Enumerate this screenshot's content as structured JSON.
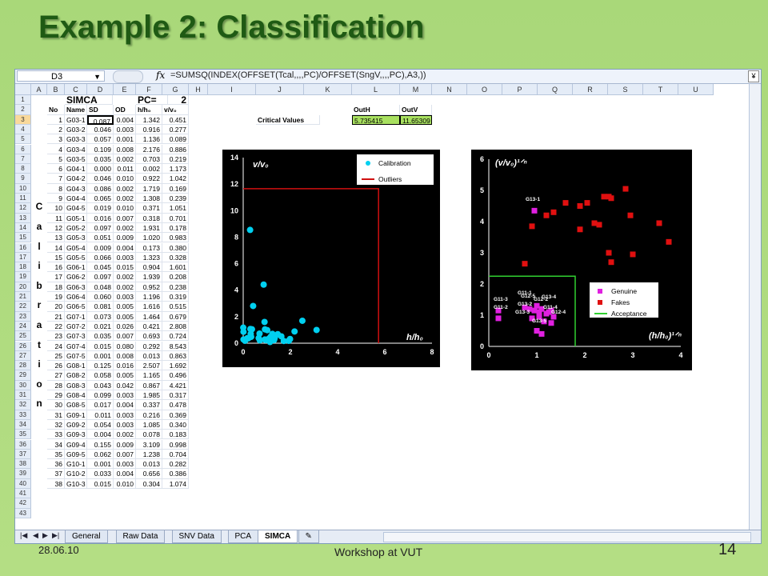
{
  "slide": {
    "title": "Example 2: Classification",
    "date": "28.06.10",
    "footer": "Workshop at VUT",
    "page": "14"
  },
  "formula_bar": {
    "name_box": "D3",
    "fx": "fx",
    "formula": "=SUMSQ(INDEX(OFFSET(Tcal,,,,PC)/OFFSET(SngV,,,,PC),A3,))"
  },
  "columns": [
    "A",
    "B",
    "C",
    "D",
    "E",
    "F",
    "G",
    "H",
    "I",
    "J",
    "K",
    "L",
    "M",
    "N",
    "O",
    "P",
    "Q",
    "R",
    "S",
    "T",
    "U"
  ],
  "sheet": {
    "title": "SIMCA",
    "pc_label": "PC=",
    "pc_value": "2",
    "headers": [
      "No",
      "Name",
      "SD",
      "OD",
      "h/h₀",
      "v/v₀"
    ],
    "critical_label": "Critical Values",
    "outh_label": "OutH",
    "outv_label": "OutV",
    "outh_value": "5.735415",
    "outv_value": "11.65309",
    "calibration_letters": [
      "C",
      "a",
      "l",
      "i",
      "b",
      "r",
      "a",
      "t",
      "i",
      "o",
      "n"
    ],
    "rows": [
      [
        "1",
        "G03-1",
        "0.087",
        "0.004",
        "1.342",
        "0.451"
      ],
      [
        "2",
        "G03-2",
        "0.046",
        "0.003",
        "0.916",
        "0.277"
      ],
      [
        "3",
        "G03-3",
        "0.057",
        "0.001",
        "1.136",
        "0.089"
      ],
      [
        "4",
        "G03-4",
        "0.109",
        "0.008",
        "2.176",
        "0.886"
      ],
      [
        "5",
        "G03-5",
        "0.035",
        "0.002",
        "0.703",
        "0.219"
      ],
      [
        "6",
        "G04-1",
        "0.000",
        "0.011",
        "0.002",
        "1.173"
      ],
      [
        "7",
        "G04-2",
        "0.046",
        "0.010",
        "0.922",
        "1.042"
      ],
      [
        "8",
        "G04-3",
        "0.086",
        "0.002",
        "1.719",
        "0.169"
      ],
      [
        "9",
        "G04-4",
        "0.065",
        "0.002",
        "1.308",
        "0.239"
      ],
      [
        "10",
        "G04-5",
        "0.019",
        "0.010",
        "0.371",
        "1.051"
      ],
      [
        "11",
        "G05-1",
        "0.016",
        "0.007",
        "0.318",
        "0.701"
      ],
      [
        "12",
        "G05-2",
        "0.097",
        "0.002",
        "1.931",
        "0.178"
      ],
      [
        "13",
        "G05-3",
        "0.051",
        "0.009",
        "1.020",
        "0.983"
      ],
      [
        "14",
        "G05-4",
        "0.009",
        "0.004",
        "0.173",
        "0.380"
      ],
      [
        "15",
        "G05-5",
        "0.066",
        "0.003",
        "1.323",
        "0.328"
      ],
      [
        "16",
        "G06-1",
        "0.045",
        "0.015",
        "0.904",
        "1.601"
      ],
      [
        "17",
        "G06-2",
        "0.097",
        "0.002",
        "1.939",
        "0.208"
      ],
      [
        "18",
        "G06-3",
        "0.048",
        "0.002",
        "0.952",
        "0.238"
      ],
      [
        "19",
        "G06-4",
        "0.060",
        "0.003",
        "1.196",
        "0.319"
      ],
      [
        "20",
        "G06-5",
        "0.081",
        "0.005",
        "1.616",
        "0.515"
      ],
      [
        "21",
        "G07-1",
        "0.073",
        "0.005",
        "1.464",
        "0.679"
      ],
      [
        "22",
        "G07-2",
        "0.021",
        "0.026",
        "0.421",
        "2.808"
      ],
      [
        "23",
        "G07-3",
        "0.035",
        "0.007",
        "0.693",
        "0.724"
      ],
      [
        "24",
        "G07-4",
        "0.015",
        "0.080",
        "0.292",
        "8.543"
      ],
      [
        "25",
        "G07-5",
        "0.001",
        "0.008",
        "0.013",
        "0.863"
      ],
      [
        "26",
        "G08-1",
        "0.125",
        "0.016",
        "2.507",
        "1.692"
      ],
      [
        "27",
        "G08-2",
        "0.058",
        "0.005",
        "1.165",
        "0.496"
      ],
      [
        "28",
        "G08-3",
        "0.043",
        "0.042",
        "0.867",
        "4.421"
      ],
      [
        "29",
        "G08-4",
        "0.099",
        "0.003",
        "1.985",
        "0.317"
      ],
      [
        "30",
        "G08-5",
        "0.017",
        "0.004",
        "0.337",
        "0.478"
      ],
      [
        "31",
        "G09-1",
        "0.011",
        "0.003",
        "0.216",
        "0.369"
      ],
      [
        "32",
        "G09-2",
        "0.054",
        "0.003",
        "1.085",
        "0.340"
      ],
      [
        "33",
        "G09-3",
        "0.004",
        "0.002",
        "0.078",
        "0.183"
      ],
      [
        "34",
        "G09-4",
        "0.155",
        "0.009",
        "3.109",
        "0.998"
      ],
      [
        "35",
        "G09-5",
        "0.062",
        "0.007",
        "1.238",
        "0.704"
      ],
      [
        "36",
        "G10-1",
        "0.001",
        "0.003",
        "0.013",
        "0.282"
      ],
      [
        "37",
        "G10-2",
        "0.033",
        "0.004",
        "0.656",
        "0.386"
      ],
      [
        "38",
        "G10-3",
        "0.015",
        "0.010",
        "0.304",
        "1.074"
      ]
    ]
  },
  "tabs": [
    "General",
    "Raw Data",
    "SNV Data",
    "PCA",
    "SIMCA"
  ],
  "active_tab": "SIMCA",
  "chart_data": [
    {
      "type": "scatter",
      "title": "",
      "xlabel": "h/h₀",
      "ylabel": "v/v₀",
      "xlim": [
        0,
        8
      ],
      "ylim": [
        0,
        14
      ],
      "xticks": [
        0,
        2,
        4,
        6,
        8
      ],
      "yticks": [
        0,
        2,
        4,
        6,
        8,
        10,
        12,
        14
      ],
      "legend_position": "top-right",
      "series": [
        {
          "name": "Calibration",
          "color": "#00d0f0",
          "x": [
            1.342,
            0.916,
            1.136,
            2.176,
            0.703,
            0.002,
            0.922,
            1.719,
            1.308,
            0.371,
            0.318,
            1.931,
            1.02,
            0.173,
            1.323,
            0.904,
            1.939,
            0.952,
            1.196,
            1.616,
            1.464,
            0.421,
            0.693,
            0.292,
            0.013,
            2.507,
            1.165,
            0.867,
            1.985,
            0.337,
            0.216,
            1.085,
            0.078,
            3.109,
            1.238,
            0.013,
            0.656,
            0.304
          ],
          "y": [
            0.451,
            0.277,
            0.089,
            0.886,
            0.219,
            1.173,
            1.042,
            0.169,
            0.239,
            1.051,
            0.701,
            0.178,
            0.983,
            0.38,
            0.328,
            1.601,
            0.208,
            0.238,
            0.319,
            0.515,
            0.679,
            2.808,
            0.724,
            8.543,
            0.863,
            1.692,
            0.496,
            4.421,
            0.317,
            0.478,
            0.369,
            0.34,
            0.183,
            0.998,
            0.704,
            0.282,
            0.386,
            1.074
          ]
        },
        {
          "name": "Outliers",
          "color": "#d01010",
          "type": "line",
          "x": [
            0,
            5.735,
            5.735
          ],
          "y": [
            11.653,
            11.653,
            0
          ]
        }
      ]
    },
    {
      "type": "scatter",
      "title": "",
      "xlabel": "(h/h₀)¹ᐟⁿ",
      "ylabel": "(v/v₀)¹ᐟⁿ",
      "xlim": [
        0,
        4
      ],
      "ylim": [
        0,
        6
      ],
      "xticks": [
        0,
        1,
        2,
        3,
        4
      ],
      "yticks": [
        0,
        1,
        2,
        3,
        4,
        5,
        6
      ],
      "legend_position": "bottom-right",
      "series": [
        {
          "name": "Genuine",
          "color": "#e020e0",
          "x": [
            0.2,
            0.2,
            0.75,
            0.85,
            0.95,
            1.0,
            1.05,
            1.1,
            1.2,
            1.25,
            1.3,
            1.35,
            0.9,
            1.05,
            1.15,
            1.3,
            1.0,
            1.1,
            0.95
          ],
          "y": [
            1.15,
            0.9,
            1.25,
            1.2,
            1.15,
            1.3,
            1.1,
            1.2,
            1.05,
            1.1,
            1.15,
            0.95,
            0.9,
            0.95,
            0.8,
            0.75,
            0.5,
            0.4,
            4.35
          ]
        },
        {
          "name": "Fakes",
          "color": "#e01010",
          "x": [
            0.9,
            0.75,
            1.2,
            1.35,
            1.6,
            1.9,
            2.05,
            2.2,
            2.3,
            2.4,
            2.5,
            2.55,
            2.85,
            2.95,
            3.55,
            3.75,
            2.5,
            2.55,
            3.0,
            1.9
          ],
          "y": [
            3.85,
            2.65,
            4.2,
            4.3,
            4.6,
            4.5,
            4.6,
            3.95,
            3.9,
            4.8,
            4.8,
            4.75,
            5.05,
            4.2,
            3.95,
            3.35,
            3.0,
            2.7,
            2.95,
            3.75
          ]
        },
        {
          "name": "Acceptance",
          "color": "#30d030",
          "type": "line",
          "x": [
            0,
            1.8,
            1.8
          ],
          "y": [
            2.25,
            2.25,
            0
          ]
        }
      ],
      "annotations": [
        "G13-1",
        "G11-3",
        "G11-2",
        "G13-3",
        "G13-4",
        "G11-1",
        "G11-4",
        "G13-2",
        "G12-2",
        "G12-4",
        "G13-5",
        "G12-5"
      ]
    }
  ]
}
